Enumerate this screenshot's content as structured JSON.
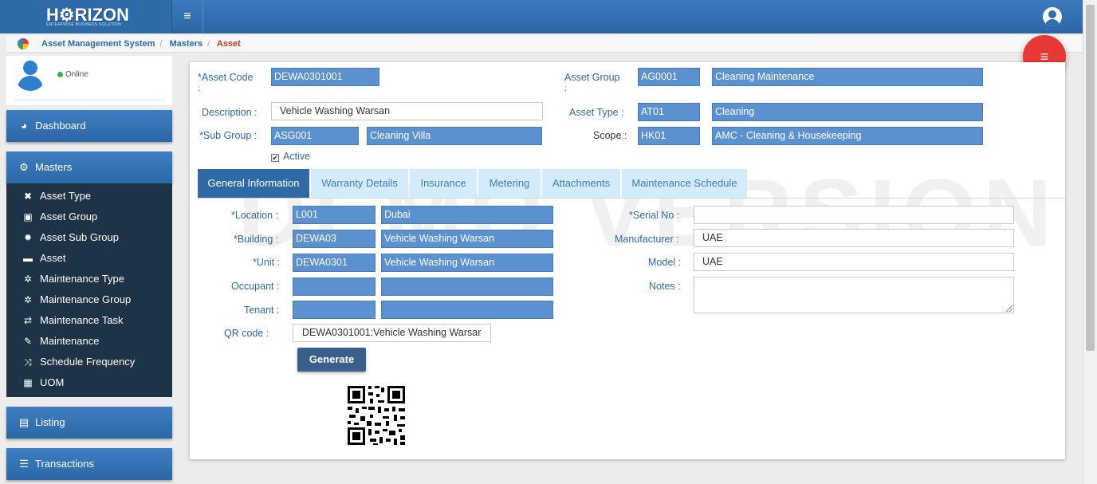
{
  "app": {
    "logo": "H⚙RIZON",
    "logo_sub": "ENTERPRISE BUSINESS SOLUTION",
    "menu_icon": "≡"
  },
  "breadcrumb": [
    "Asset Management System",
    "Masters",
    "Asset"
  ],
  "sidebar": {
    "status": "Online",
    "dashboard": "Dashboard",
    "masters": "Masters",
    "items": [
      {
        "label": "Asset Type",
        "icon": "✖"
      },
      {
        "label": "Asset Group",
        "icon": "▣"
      },
      {
        "label": "Asset Sub Group",
        "icon": "✹"
      },
      {
        "label": "Asset",
        "icon": "▬"
      },
      {
        "label": "Maintenance Type",
        "icon": "✲"
      },
      {
        "label": "Maintenance Group",
        "icon": "✲"
      },
      {
        "label": "Maintenance Task",
        "icon": "⇄"
      },
      {
        "label": "Maintenance",
        "icon": "✎"
      },
      {
        "label": "Schedule Frequency",
        "icon": "⤨"
      },
      {
        "label": "UOM",
        "icon": "▦"
      }
    ],
    "listing": "Listing",
    "transactions": "Transactions"
  },
  "form": {
    "asset_code_label": "*Asset Code",
    "asset_code_sub": ":",
    "asset_code": "DEWA0301001",
    "asset_group_label": "Asset Group",
    "asset_group_sub": ":",
    "asset_group_code": "AG0001",
    "asset_group_name": "Cleaning Maintenance",
    "description_label": "Description :",
    "description": "Vehicle Washing Warsan",
    "asset_type_label": "Asset Type :",
    "asset_type_code": "AT01",
    "asset_type_name": "Cleaning",
    "sub_group_label": "*Sub Group :",
    "sub_group_code": "ASG001",
    "sub_group_name": "Cleaning Villa",
    "scope_label": "Scope :",
    "scope_code": "HK01",
    "scope_name": "AMC - Cleaning & Housekeeping",
    "active_label": "Active",
    "active_check": "✔"
  },
  "tabs": [
    "General Information",
    "Warranty Details",
    "Insurance",
    "Metering",
    "Attachments",
    "Maintenance Schedule"
  ],
  "general": {
    "location_label": "*Location :",
    "location_code": "L001",
    "location_name": "Dubai",
    "building_label": "*Building :",
    "building_code": "DEWA03",
    "building_name": "Vehicle Washing Warsan",
    "unit_label": "*Unit :",
    "unit_code": "DEWA0301",
    "unit_name": "Vehicle Washing Warsan",
    "occupant_label": "Occupant :",
    "occupant_code": "",
    "occupant_name": "",
    "tenant_label": "Tenant :",
    "tenant_code": "",
    "tenant_name": "",
    "qr_label": "QR code :",
    "qr_value": "DEWA0301001:Vehicle Washing Warsar",
    "generate_label": "Generate",
    "serial_label": "*Serial No :",
    "serial": "",
    "manufacturer_label": "Manufacturer :",
    "manufacturer": "UAE",
    "model_label": "Model :",
    "model": "UAE",
    "notes_label": "Notes :",
    "notes": ""
  },
  "watermark": "DEMO VERSION"
}
